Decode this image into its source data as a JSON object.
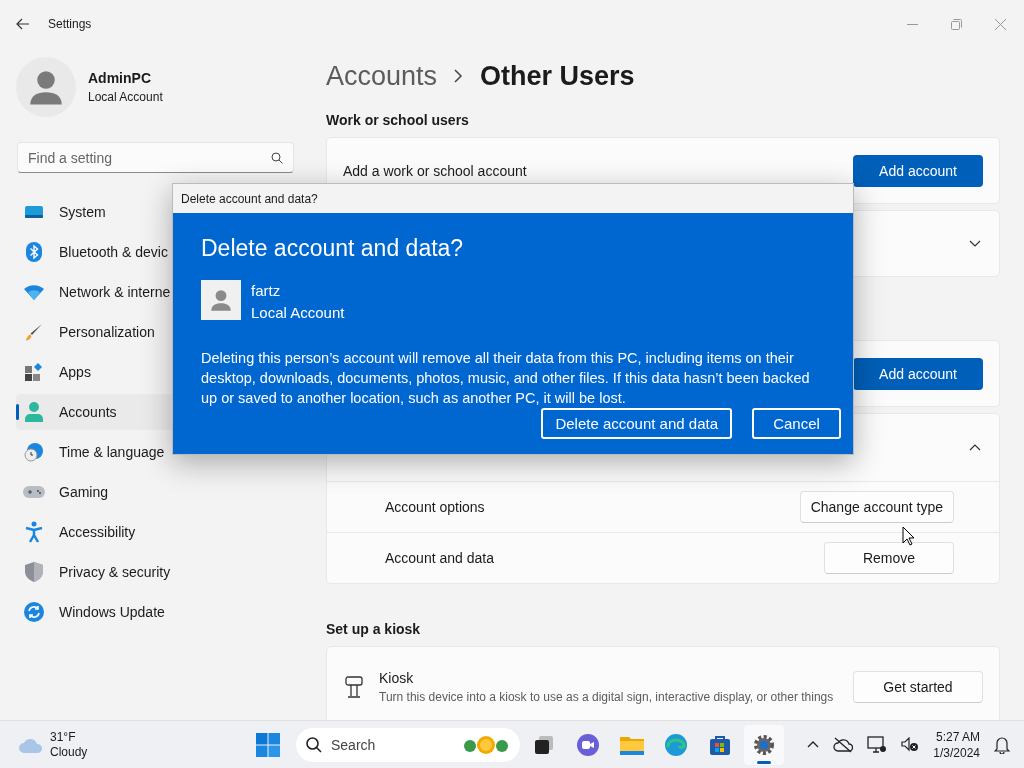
{
  "window": {
    "title": "Settings"
  },
  "user": {
    "name": "AdminPC",
    "type": "Local Account"
  },
  "search": {
    "placeholder": "Find a setting"
  },
  "nav": [
    {
      "label": "System",
      "selected": false
    },
    {
      "label": "Bluetooth & devic",
      "selected": false
    },
    {
      "label": "Network & interne",
      "selected": false
    },
    {
      "label": "Personalization",
      "selected": false
    },
    {
      "label": "Apps",
      "selected": false
    },
    {
      "label": "Accounts",
      "selected": true
    },
    {
      "label": "Time & language",
      "selected": false
    },
    {
      "label": "Gaming",
      "selected": false
    },
    {
      "label": "Accessibility",
      "selected": false
    },
    {
      "label": "Privacy & security",
      "selected": false
    },
    {
      "label": "Windows Update",
      "selected": false
    }
  ],
  "breadcrumb": [
    "Accounts",
    "Other Users"
  ],
  "work_section": {
    "heading": "Work or school users",
    "add_label": "Add a work or school account",
    "add_button": "Add account",
    "account_card": {
      "expanded": false
    }
  },
  "other_users": {
    "add_button": "Add account",
    "user_card": {
      "expanded": true,
      "rows": [
        {
          "label": "Account options",
          "button": "Change account type"
        },
        {
          "label": "Account and data",
          "button": "Remove"
        }
      ]
    }
  },
  "kiosk_section": {
    "heading": "Set up a kiosk",
    "title": "Kiosk",
    "description": "Turn this device into a kiosk to use as a digital sign, interactive display, or other things",
    "button": "Get started"
  },
  "dialog": {
    "window_title": "Delete account and data?",
    "heading": "Delete account and data?",
    "user": {
      "name": "fartz",
      "type": "Local Account"
    },
    "message": "Deleting this person’s account will remove all their data from this PC, including items on their desktop, downloads, documents, photos, music, and other files. If this data hasn’t been backed up or saved to another location, such as another PC, it will be lost.",
    "buttons": [
      "Delete account and data",
      "Cancel"
    ]
  },
  "taskbar": {
    "weather": {
      "temperature": "31°F",
      "condition": "Cloudy"
    },
    "search_placeholder": "Search",
    "apps": [
      {
        "running": false
      },
      {
        "running": false
      },
      {
        "running": false
      },
      {
        "running": false
      },
      {
        "running": false
      },
      {
        "running": true
      }
    ],
    "time": "5:27 AM",
    "date": "1/3/2024"
  }
}
